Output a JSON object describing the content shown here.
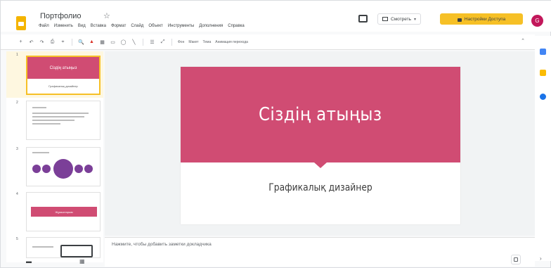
{
  "header": {
    "title": "Портфолио",
    "star": "☆",
    "menu": [
      "Файл",
      "Изменить",
      "Вид",
      "Вставка",
      "Формат",
      "Слайд",
      "Объект",
      "Инструменты",
      "Дополнения",
      "Справка"
    ],
    "present_label": "Смотреть",
    "share_label": "Настройки Доступа",
    "avatar_letter": "G"
  },
  "toolbar": {
    "items": [
      "+",
      "↶",
      "↷",
      "⎙",
      "⌖",
      "🔍",
      "▦",
      "▭",
      "◯",
      "╲",
      "☰",
      "⤢"
    ],
    "texts": [
      "Фон",
      "Макет",
      "Тема",
      "Анимация перехода"
    ]
  },
  "filmstrip": {
    "slides": [
      {
        "num": "1",
        "title": "Сіздің атыңыз",
        "subtitle": "Графикалық дизайнер"
      },
      {
        "num": "2"
      },
      {
        "num": "3"
      },
      {
        "num": "4",
        "band": "Жұмыстарым"
      },
      {
        "num": "5"
      }
    ]
  },
  "slide": {
    "title": "Сіздің атыңыз",
    "subtitle": "Графикалық дизайнер"
  },
  "notes": {
    "placeholder": "Нажмите, чтобы добавить заметки докладчика"
  },
  "colors": {
    "accent": "#d04c73",
    "share": "#f6c026",
    "avatar": "#c2185b"
  }
}
